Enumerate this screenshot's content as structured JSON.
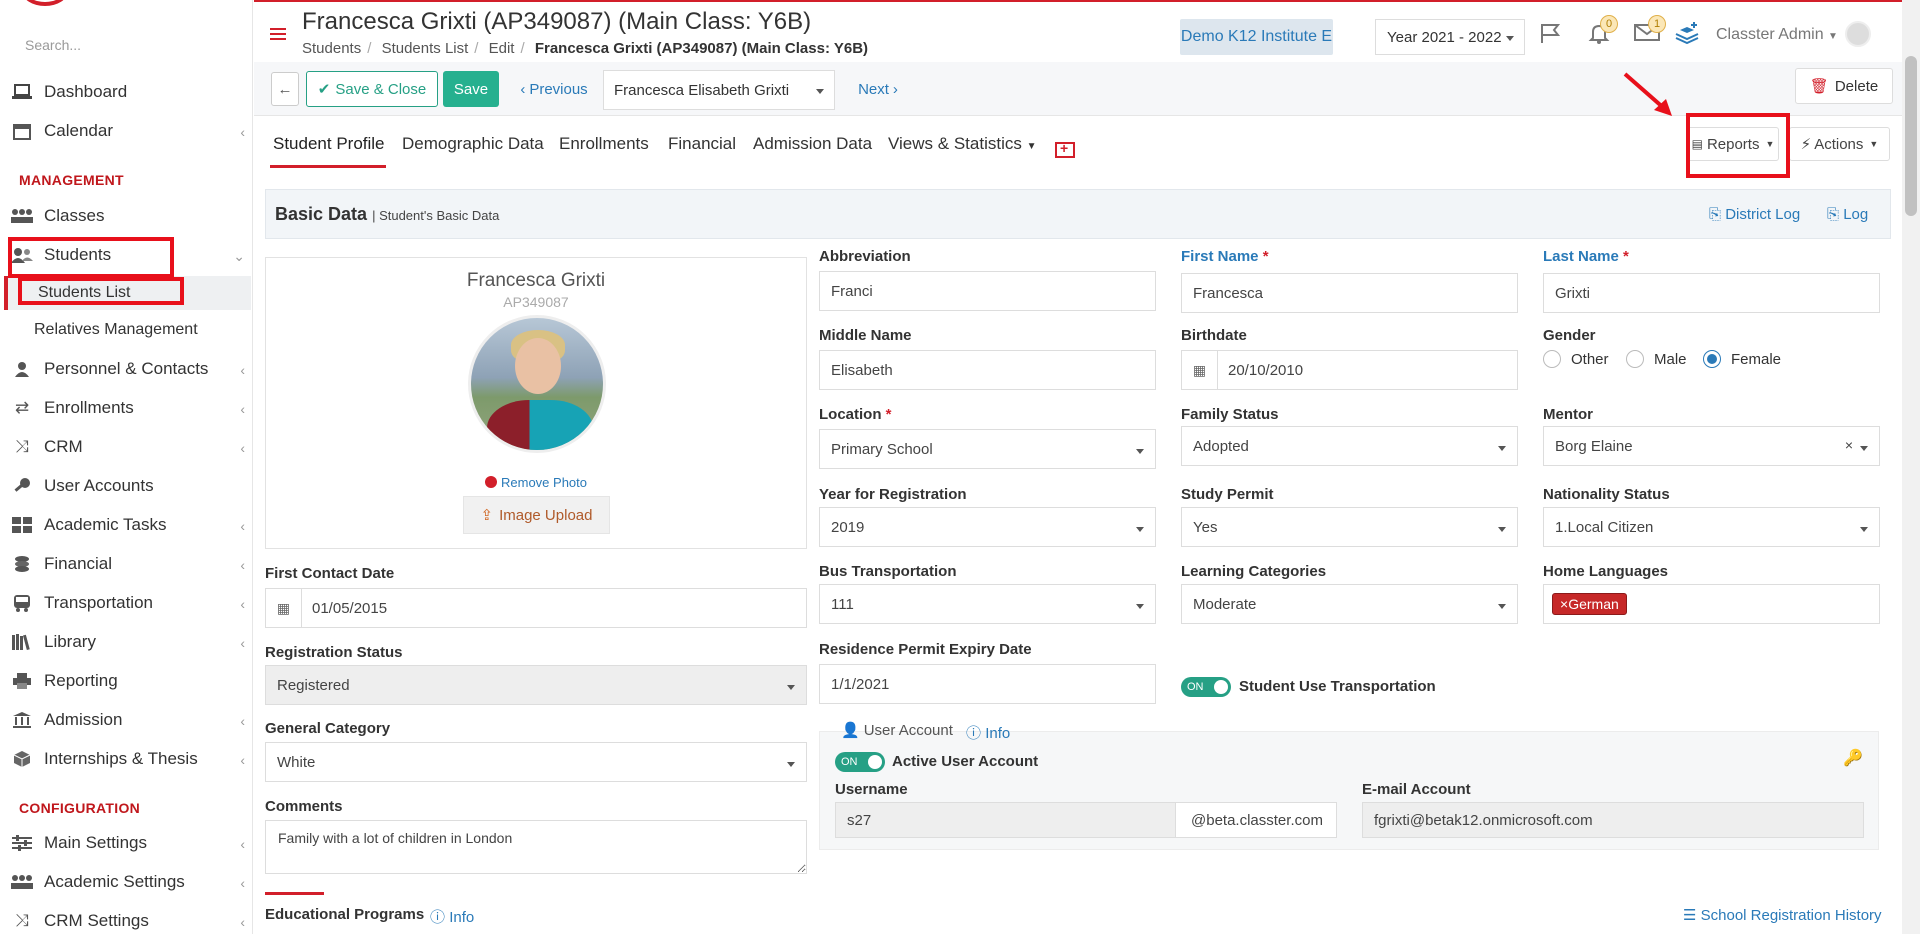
{
  "sidebar": {
    "search_placeholder": "Search...",
    "items": [
      {
        "label": "Dashboard"
      },
      {
        "label": "Calendar"
      },
      {
        "label": "Classes"
      },
      {
        "label": "Students"
      },
      {
        "label": "Personnel & Contacts"
      },
      {
        "label": "Enrollments"
      },
      {
        "label": "CRM"
      },
      {
        "label": "User Accounts"
      },
      {
        "label": "Academic Tasks"
      },
      {
        "label": "Financial"
      },
      {
        "label": "Transportation"
      },
      {
        "label": "Library"
      },
      {
        "label": "Reporting"
      },
      {
        "label": "Admission"
      },
      {
        "label": "Internships & Thesis"
      },
      {
        "label": "Main Settings"
      },
      {
        "label": "Academic Settings"
      },
      {
        "label": "CRM Settings"
      }
    ],
    "section_management": "MANAGEMENT",
    "section_configuration": "CONFIGURATION",
    "sub_students_list": "Students List",
    "sub_relatives": "Relatives Management"
  },
  "header": {
    "title": "Francesca Grixti (AP349087) (Main Class: Y6B)",
    "breadcrumb": [
      "Students",
      "Students List",
      "Edit",
      "Francesca Grixti (AP349087) (Main Class: Y6B)"
    ],
    "institute": "Demo K12 Institute E",
    "year": "Year 2021 - 2022",
    "notifications_count": "0",
    "messages_count": "1",
    "user": "Classter Admin"
  },
  "toolbar": {
    "save_close": "Save & Close",
    "save": "Save",
    "previous": "Previous",
    "student_select": "Francesca Elisabeth Grixti",
    "next": "Next",
    "delete": "Delete"
  },
  "tabs": [
    {
      "label": "Student Profile"
    },
    {
      "label": "Demographic Data"
    },
    {
      "label": "Enrollments"
    },
    {
      "label": "Financial"
    },
    {
      "label": "Admission Data"
    },
    {
      "label": "Views & Statistics"
    }
  ],
  "tab_buttons": {
    "reports": "Reports",
    "actions": "Actions"
  },
  "panel": {
    "title": "Basic Data",
    "subtitle": "| Student's Basic Data",
    "district_log": "District Log",
    "log": "Log"
  },
  "profile": {
    "name": "Francesca Grixti",
    "code": "AP349087",
    "remove_photo": "Remove Photo",
    "image_upload": "Image Upload"
  },
  "fields": {
    "abbreviation": {
      "label": "Abbreviation",
      "value": "Franci"
    },
    "first_name": {
      "label": "First Name",
      "value": "Francesca"
    },
    "last_name": {
      "label": "Last Name",
      "value": "Grixti"
    },
    "middle_name": {
      "label": "Middle Name",
      "value": "Elisabeth"
    },
    "birthdate": {
      "label": "Birthdate",
      "value": "20/10/2010"
    },
    "gender": {
      "label": "Gender",
      "options": [
        "Other",
        "Male",
        "Female"
      ],
      "selected": "Female"
    },
    "location": {
      "label": "Location",
      "value": "Primary School"
    },
    "family_status": {
      "label": "Family Status",
      "value": "Adopted"
    },
    "mentor": {
      "label": "Mentor",
      "value": "Borg Elaine"
    },
    "year_registration": {
      "label": "Year for Registration",
      "value": "2019"
    },
    "study_permit": {
      "label": "Study Permit",
      "value": "Yes"
    },
    "nationality_status": {
      "label": "Nationality Status",
      "value": "1.Local Citizen"
    },
    "first_contact": {
      "label": "First Contact Date",
      "value": "01/05/2015"
    },
    "bus_transport": {
      "label": "Bus Transportation",
      "value": "111"
    },
    "learning_categories": {
      "label": "Learning Categories",
      "value": "Moderate"
    },
    "home_languages": {
      "label": "Home Languages",
      "value": "German"
    },
    "registration_status": {
      "label": "Registration Status",
      "value": "Registered"
    },
    "residence_permit": {
      "label": "Residence Permit Expiry Date",
      "value": "1/1/2021"
    },
    "student_transport": {
      "label": "Student Use Transportation",
      "toggle": "ON"
    },
    "general_category": {
      "label": "General Category",
      "value": "White"
    },
    "comments": {
      "label": "Comments",
      "value": "Family with a lot of children in London"
    }
  },
  "user_account": {
    "title": "User Account",
    "info": "Info",
    "active_label": "Active User Account",
    "toggle": "ON",
    "username_label": "Username",
    "username": "s27",
    "domain": "@beta.classter.com",
    "email_label": "E-mail Account",
    "email": "fgrixti@betak12.onmicrosoft.com"
  },
  "educational": {
    "title": "Educational Programs",
    "info": "Info",
    "history": "School Registration History"
  },
  "colors": {
    "brand_red": "#d21f2a",
    "accent_blue": "#2a7ab8",
    "success_green": "#26a085"
  }
}
